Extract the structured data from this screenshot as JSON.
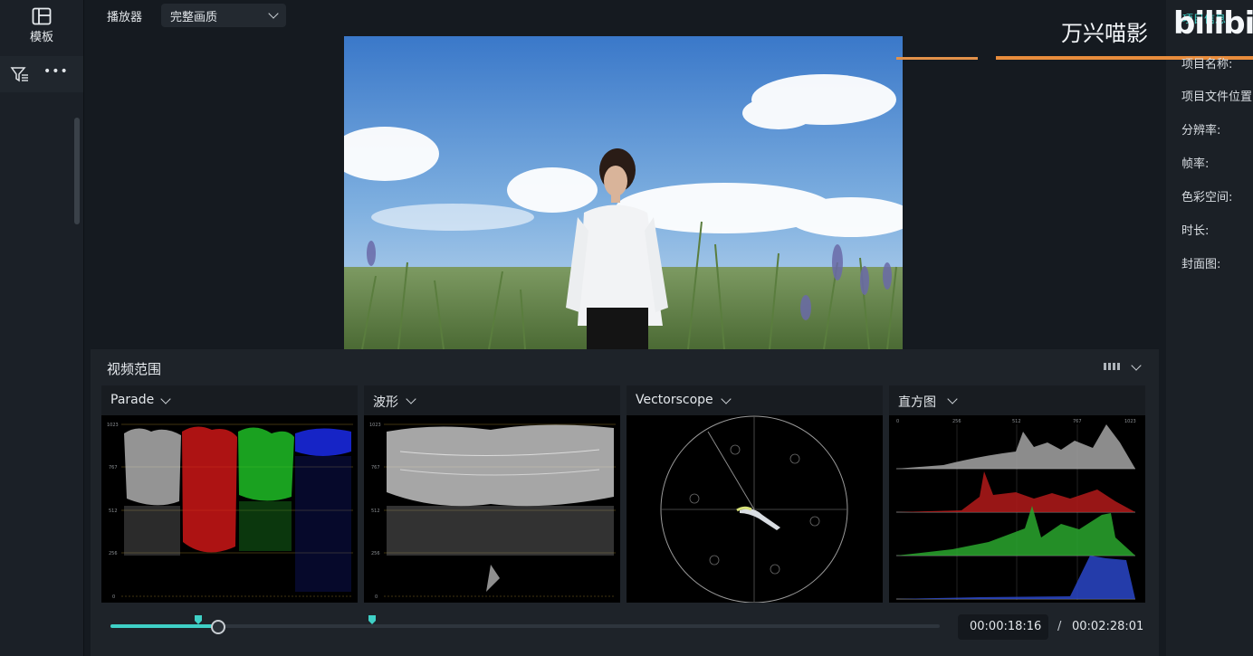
{
  "left_panel": {
    "template_label": "模板",
    "more_label": "•••"
  },
  "player": {
    "label": "播放器",
    "quality": "完整画质"
  },
  "brand": {
    "watermark": "万兴喵影",
    "logo": "bilibili"
  },
  "project_info": {
    "tab_label": "项目信息",
    "fields": [
      "项目名称:",
      "项目文件位置",
      "分辨率:",
      "帧率:",
      "色彩空间:",
      "时长:",
      "封面图:"
    ]
  },
  "scopes": {
    "title": "视频范围",
    "panels": [
      {
        "label": "Parade"
      },
      {
        "label": "波形"
      },
      {
        "label": "Vectorscope"
      },
      {
        "label": "直方图"
      }
    ],
    "waveform_ticks": [
      "1023",
      "767",
      "512",
      "256",
      "0"
    ],
    "histogram_ticks": [
      "0",
      "256",
      "512",
      "767",
      "1023"
    ]
  },
  "timeline": {
    "progress": 0.13,
    "current_time": "00:00:18:16",
    "separator": "/",
    "total_time": "00:02:28:01"
  },
  "colors": {
    "accent": "#3fd0c6",
    "panel": "#1e2329"
  }
}
